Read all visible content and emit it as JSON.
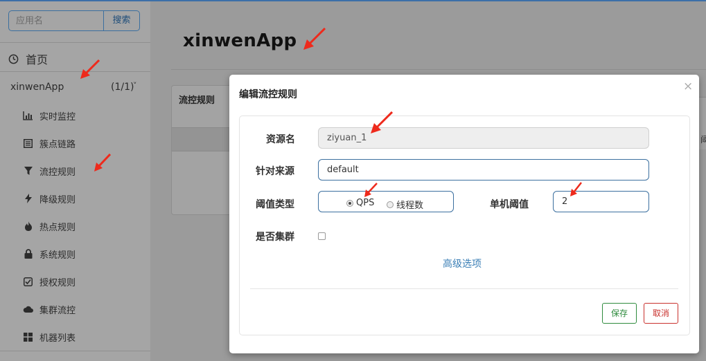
{
  "sidebar": {
    "search_placeholder": "应用名",
    "search_button": "搜索",
    "home_label": "首页",
    "app_name": "xinwenApp",
    "app_count": "(1/1)",
    "items": [
      {
        "label": "实时监控",
        "icon": "bar-chart-icon"
      },
      {
        "label": "簇点链路",
        "icon": "list-icon"
      },
      {
        "label": "流控规则",
        "icon": "filter-icon"
      },
      {
        "label": "降级规则",
        "icon": "flash-icon"
      },
      {
        "label": "热点规则",
        "icon": "fire-icon"
      },
      {
        "label": "系统规则",
        "icon": "lock-icon"
      },
      {
        "label": "授权规则",
        "icon": "check-square-icon"
      },
      {
        "label": "集群流控",
        "icon": "cloud-icon"
      },
      {
        "label": "机器列表",
        "icon": "grid-icon"
      }
    ]
  },
  "main": {
    "title": "xinwenApp",
    "panel_title": "流控规则",
    "right_fragment": "阈"
  },
  "modal": {
    "title": "编辑流控规则",
    "close": "×",
    "resource_label": "资源名",
    "resource_value": "ziyuan_1",
    "source_label": "针对来源",
    "source_value": "default",
    "threshold_type_label": "阈值类型",
    "radio_qps": "QPS",
    "radio_threads": "线程数",
    "threshold_label": "单机阈值",
    "threshold_value": "2",
    "cluster_label": "是否集群",
    "advanced_link": "高级选项",
    "save_button": "保存",
    "cancel_button": "取消"
  },
  "colors": {
    "accent": "#3b6f9f",
    "link": "#3b7fb6",
    "save": "#2e8b3d",
    "cancel": "#c9302c",
    "annotation_arrow": "#ee2a1c"
  }
}
